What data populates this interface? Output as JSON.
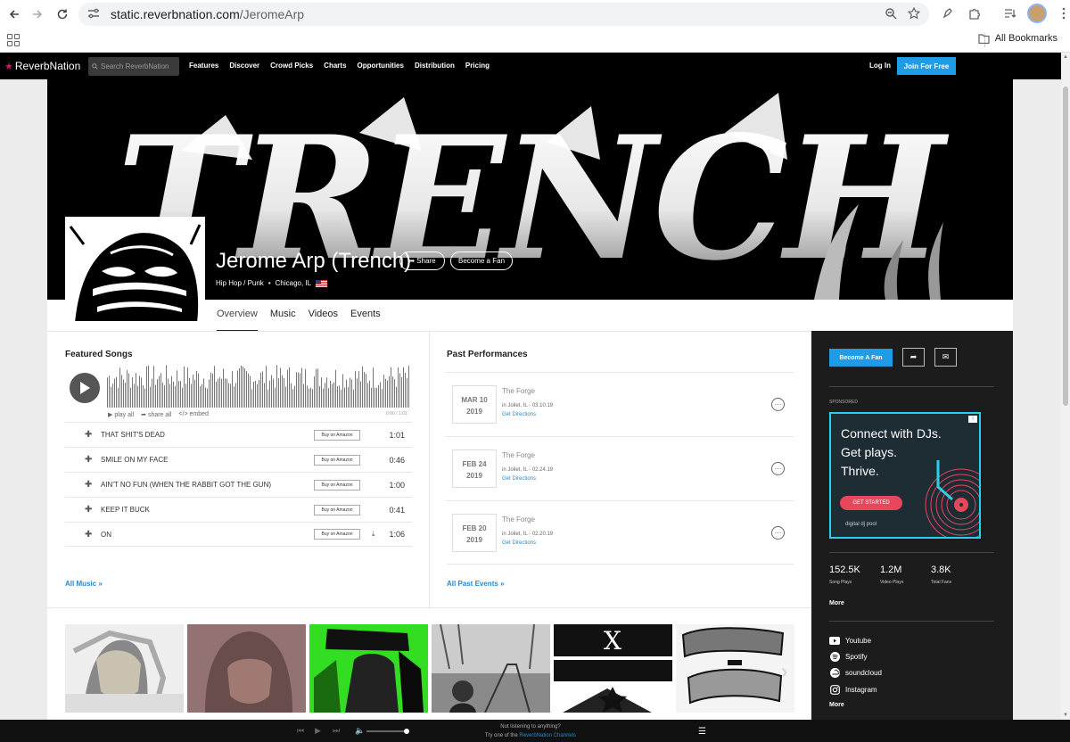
{
  "browser": {
    "url_host": "static.reverbnation.com",
    "url_path": "/JeromeArp",
    "all_bookmarks": "All Bookmarks"
  },
  "nav": {
    "logo": "ReverbNation",
    "search_placeholder": "Search ReverbNation",
    "links": [
      "Features",
      "Discover",
      "Crowd Picks",
      "Charts",
      "Opportunities",
      "Distribution",
      "Pricing"
    ],
    "login": "Log In",
    "join": "Join For Free"
  },
  "artist": {
    "name": "Jerome Arp (Trench)",
    "genre": "Hip Hop / Punk",
    "location": "Chicago, IL",
    "share": "Share",
    "become_fan": "Become a Fan",
    "banner_text": "TRENCH"
  },
  "tabs": [
    "Overview",
    "Music",
    "Videos",
    "Events"
  ],
  "featured": {
    "title": "Featured Songs",
    "play_all": "play all",
    "share_all": "share all",
    "embed": "embed",
    "time": "0:00 / 1:01",
    "buy_label": "Buy on Amazon",
    "songs": [
      {
        "title": "THAT SHIT'S DEAD",
        "duration": "1:01"
      },
      {
        "title": "SMILE ON MY FACE",
        "duration": "0:46"
      },
      {
        "title": "AIN'T NO FUN (WHEN THE RABBIT GOT THE GUN)",
        "duration": "1:00"
      },
      {
        "title": "KEEP IT BUCK",
        "duration": "0:41"
      },
      {
        "title": "ON",
        "duration": "1:06"
      }
    ],
    "all_link": "All Music »"
  },
  "performances": {
    "title": "Past Performances",
    "items": [
      {
        "month": "MAR 10",
        "year": "2019",
        "venue": "The Forge",
        "loc": "in Joliet, IL - 03.10.19",
        "dir": "Get Directions"
      },
      {
        "month": "FEB 24",
        "year": "2019",
        "venue": "The Forge",
        "loc": "in Joliet, IL - 02.24.19",
        "dir": "Get Directions"
      },
      {
        "month": "FEB 20",
        "year": "2019",
        "venue": "The Forge",
        "loc": "in Joliet, IL - 02.20.19",
        "dir": "Get Directions"
      }
    ],
    "all_link": "All Past Events »"
  },
  "sidebar": {
    "become_fan": "Become A Fan",
    "sponsored": "SPONSORED",
    "ad": {
      "line1": "Connect with DJs.",
      "line2": "Get plays.",
      "line3": "Thrive.",
      "button": "GET STARTED",
      "brand": "digital dj pool"
    },
    "stats": [
      {
        "num": "152.5K",
        "label": "Song Plays"
      },
      {
        "num": "1.2M",
        "label": "Video Plays"
      },
      {
        "num": "3.8K",
        "label": "Total Fans"
      }
    ],
    "more": "More",
    "social": [
      "Youtube",
      "Spotify",
      "soundcloud",
      "Instagram"
    ],
    "more2": "More"
  },
  "player": {
    "line1": "Not listening to anything?",
    "line2_a": "Try one of the",
    "line2_b": "ReverbNation Channels"
  },
  "colors": {
    "accent": "#1e9de6",
    "link": "#1e8bd2",
    "logo_star": "#c8186c",
    "ad_border": "#2ad0e6",
    "ad_button": "#e8465c"
  }
}
